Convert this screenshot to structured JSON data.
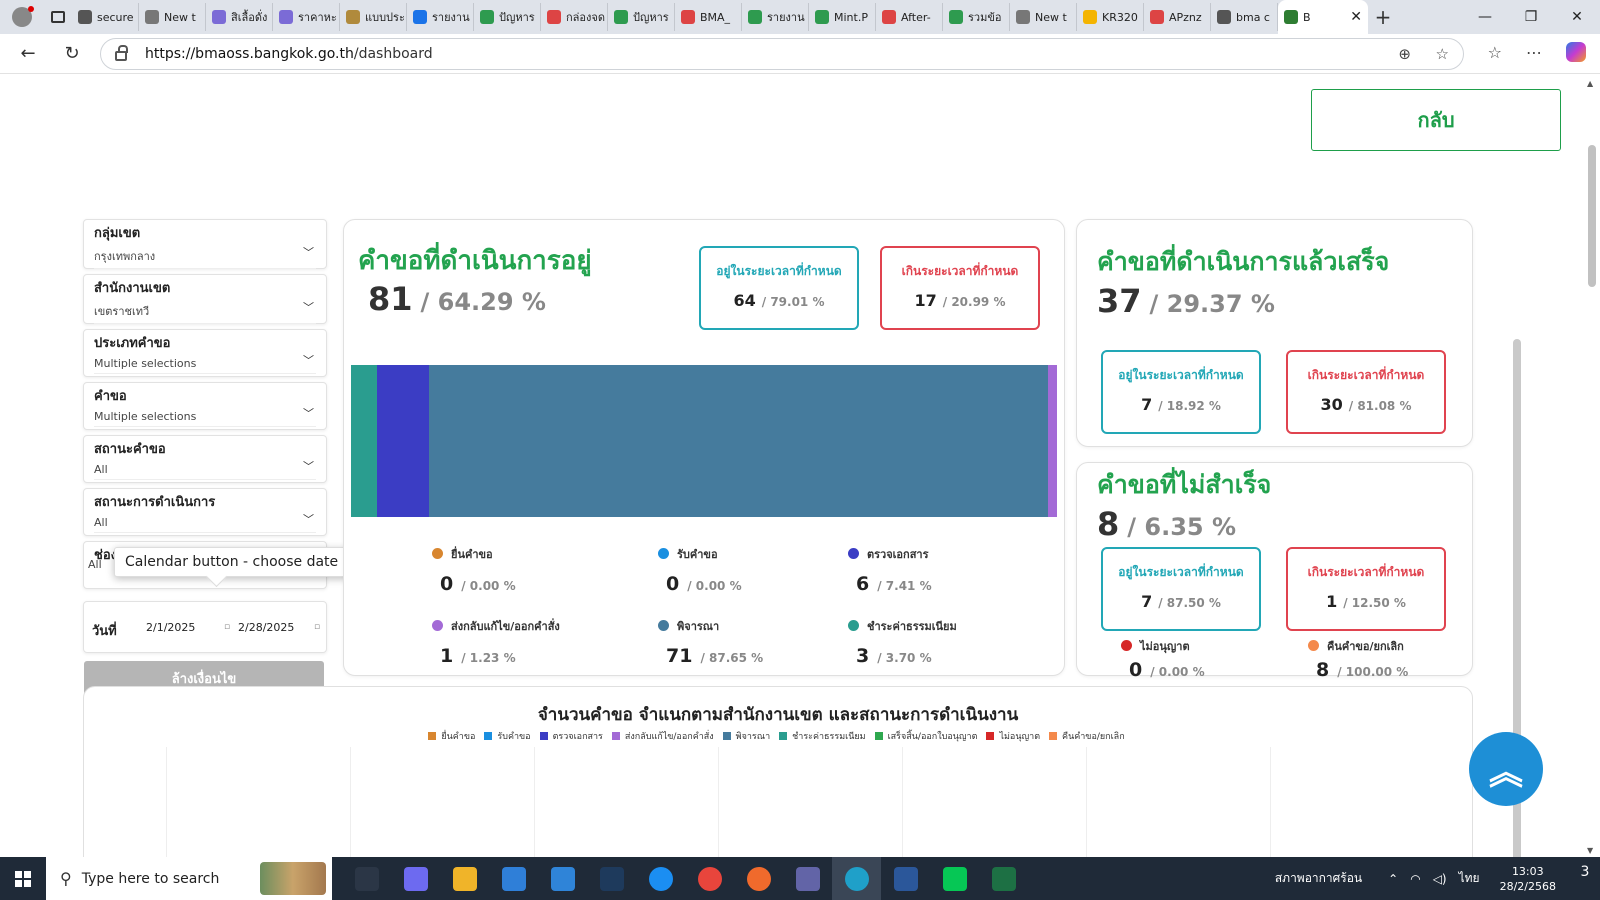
{
  "browser": {
    "tabs": [
      {
        "label": "secure",
        "color": "#555"
      },
      {
        "label": "New t",
        "color": "#777"
      },
      {
        "label": "สิเลื้อดั่ง",
        "color": "#7b6bd6"
      },
      {
        "label": "ราคาหะ",
        "color": "#7b6bd6"
      },
      {
        "label": "แบบประ",
        "color": "#b08a3c"
      },
      {
        "label": "รายงาน",
        "color": "#1a73e8"
      },
      {
        "label": "ปัญหาร",
        "color": "#2e9b4f"
      },
      {
        "label": "กล่องจด",
        "color": "#d44"
      },
      {
        "label": "ปัญหาร",
        "color": "#2e9b4f"
      },
      {
        "label": "BMA_",
        "color": "#d44"
      },
      {
        "label": "รายงาน",
        "color": "#2e9b4f"
      },
      {
        "label": "Mint.P",
        "color": "#2e9b4f"
      },
      {
        "label": "After-",
        "color": "#d44"
      },
      {
        "label": "รวมข้อ",
        "color": "#2e9b4f"
      },
      {
        "label": "New t",
        "color": "#777"
      },
      {
        "label": "KR320",
        "color": "#f4b400"
      },
      {
        "label": "APznz",
        "color": "#d44"
      },
      {
        "label": "bma c",
        "color": "#555"
      }
    ],
    "active_tab": {
      "label": "B",
      "close": "✕"
    },
    "new_tab": "+",
    "window_controls": [
      "—",
      "❐",
      "✕"
    ],
    "url_host": "https://bmaoss.bangkok.go.th",
    "url_path": "/dashboard"
  },
  "page": {
    "back_label": "กลับ",
    "filters": [
      {
        "label": "กลุ่มเขต",
        "value": "กรุงเทพกลาง"
      },
      {
        "label": "สำนักงานเขต",
        "value": "เขตราชเทวี"
      },
      {
        "label": "ประเภทคำขอ",
        "value": "Multiple selections"
      },
      {
        "label": "คำขอ",
        "value": "Multiple selections"
      },
      {
        "label": "สถานะคำขอ",
        "value": "All"
      },
      {
        "label": "สถานะการดำเนินการ",
        "value": "All"
      },
      {
        "label": "ช่องทางการแจ้ง",
        "value": "All"
      }
    ],
    "date_label": "วันที่",
    "date_from": "2/1/2025",
    "date_to": "2/28/2025",
    "tooltip": "Calendar button - choose date",
    "clear_label": "ล้างเงื่อนไข",
    "in_time_label": "อยู่ในระยะเวลาที่กำหนด",
    "over_time_label": "เกินระยะเวลาที่กำหนด",
    "in_progress": {
      "title": "คำขอที่ดำเนินการอยู่",
      "count": "81",
      "pct": "/ 64.29 %",
      "in_time": {
        "count": "64",
        "pct": "/ 79.01 %"
      },
      "over_time": {
        "count": "17",
        "pct": "/ 20.99 %"
      },
      "legend": [
        {
          "label": "ยื่นคำขอ",
          "count": "0",
          "pct": "/ 0.00 %",
          "color": "#d8862f"
        },
        {
          "label": "รับคำขอ",
          "count": "0",
          "pct": "/ 0.00 %",
          "color": "#1a8fe0"
        },
        {
          "label": "ตรวจเอกสาร",
          "count": "6",
          "pct": "/ 7.41 %",
          "color": "#3b3dc4"
        },
        {
          "label": "ส่งกลับแก้ไข/ออกคำสั่ง",
          "count": "1",
          "pct": "/ 1.23 %",
          "color": "#a36ad6"
        },
        {
          "label": "พิจารณา",
          "count": "71",
          "pct": "/ 87.65 %",
          "color": "#457b9d"
        },
        {
          "label": "ชำระค่าธรรมเนียม",
          "count": "3",
          "pct": "/ 3.70 %",
          "color": "#2a9d8f"
        }
      ],
      "bar_segments": [
        {
          "value": 3,
          "color": "#2a9d8f"
        },
        {
          "value": 6,
          "color": "#3b3dc4"
        },
        {
          "value": 71,
          "color": "#457b9d"
        },
        {
          "value": 1,
          "color": "#a36ad6"
        }
      ]
    },
    "completed": {
      "title": "คำขอที่ดำเนินการแล้วเสร็จ",
      "count": "37",
      "pct": "/ 29.37 %",
      "in_time": {
        "count": "7",
        "pct": "/ 18.92 %"
      },
      "over_time": {
        "count": "30",
        "pct": "/ 81.08 %"
      }
    },
    "failed": {
      "title": "คำขอที่ไม่สำเร็จ",
      "count": "8",
      "pct": "/ 6.35 %",
      "in_time": {
        "count": "7",
        "pct": "/ 87.50 %"
      },
      "over_time": {
        "count": "1",
        "pct": "/ 12.50 %"
      },
      "legend": [
        {
          "label": "ไม่อนุญาต",
          "count": "0",
          "pct": "/ 0.00 %",
          "color": "#d62828"
        },
        {
          "label": "คืนคำขอ/ยกเลิก",
          "count": "8",
          "pct": "/ 100.00 %",
          "color": "#f4894b"
        }
      ]
    },
    "chart": {
      "title": "จำนวนคำขอ  จำแนกตามสำนักงานเขต และสถานะการดำเนินงาน",
      "legend": [
        {
          "label": "ยื่นคำขอ",
          "color": "#d8862f"
        },
        {
          "label": "รับคำขอ",
          "color": "#1a8fe0"
        },
        {
          "label": "ตรวจเอกสาร",
          "color": "#3b3dc4"
        },
        {
          "label": "ส่งกลับแก้ไข/ออกคำสั่ง",
          "color": "#a36ad6"
        },
        {
          "label": "พิจารณา",
          "color": "#457b9d"
        },
        {
          "label": "ชำระค่าธรรมเนียม",
          "color": "#2a9d8f"
        },
        {
          "label": "เสร็จสิ้น/ออกใบอนุญาต",
          "color": "#2ea84f"
        },
        {
          "label": "ไม่อนุญาต",
          "color": "#d62828"
        },
        {
          "label": "คืนคำขอ/ยกเลิก",
          "color": "#f4894b"
        }
      ]
    }
  },
  "taskbar": {
    "search_placeholder": "Type here to search",
    "apps": [
      {
        "name": "task-view",
        "color": "#2b3646"
      },
      {
        "name": "copilot",
        "color": "#6d6af0"
      },
      {
        "name": "file-explorer",
        "color": "#f0b429"
      },
      {
        "name": "store",
        "color": "#2f7fd8"
      },
      {
        "name": "mail",
        "color": "#2f84d8"
      },
      {
        "name": "webex",
        "color": "#1e3a5c"
      },
      {
        "name": "ie",
        "color": "#1b8ef2"
      },
      {
        "name": "chrome",
        "color": "#e8453c"
      },
      {
        "name": "firefox",
        "color": "#f06a2c"
      },
      {
        "name": "teams",
        "color": "#6264a7"
      },
      {
        "name": "edge",
        "color": "#1fa0c9"
      },
      {
        "name": "word",
        "color": "#2b579a"
      },
      {
        "name": "line",
        "color": "#06c755"
      },
      {
        "name": "excel",
        "color": "#1d7044"
      }
    ],
    "weather": "สภาพอากาศร้อน",
    "lang": "ไทย",
    "time": "13:03",
    "date": "28/2/2568",
    "notifications": "3"
  }
}
